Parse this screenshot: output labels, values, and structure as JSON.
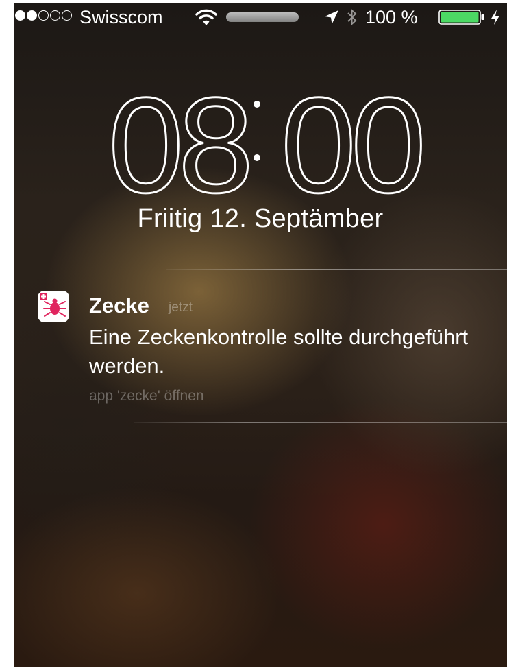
{
  "status_bar": {
    "signal_bars": 2,
    "signal_total": 5,
    "carrier": "Swisscom",
    "battery_percent": "100 %",
    "battery_level": 1.0
  },
  "lockscreen": {
    "time": "08:00",
    "time_hours": "08",
    "time_minutes": "00",
    "date": "Friitig 12. Septämber"
  },
  "notification": {
    "app_name": "Zecke",
    "time": "jetzt",
    "message": "Eine Zeckenkontrolle sollte durchgeführt werden.",
    "action": "app 'zecke' öffnen"
  },
  "colors": {
    "battery_fill": "#4cd964",
    "app_icon_accent": "#e0245e"
  },
  "icons": [
    "wifi-icon",
    "location-icon",
    "bluetooth-icon",
    "battery-icon",
    "charging-icon",
    "tick-app-icon"
  ]
}
